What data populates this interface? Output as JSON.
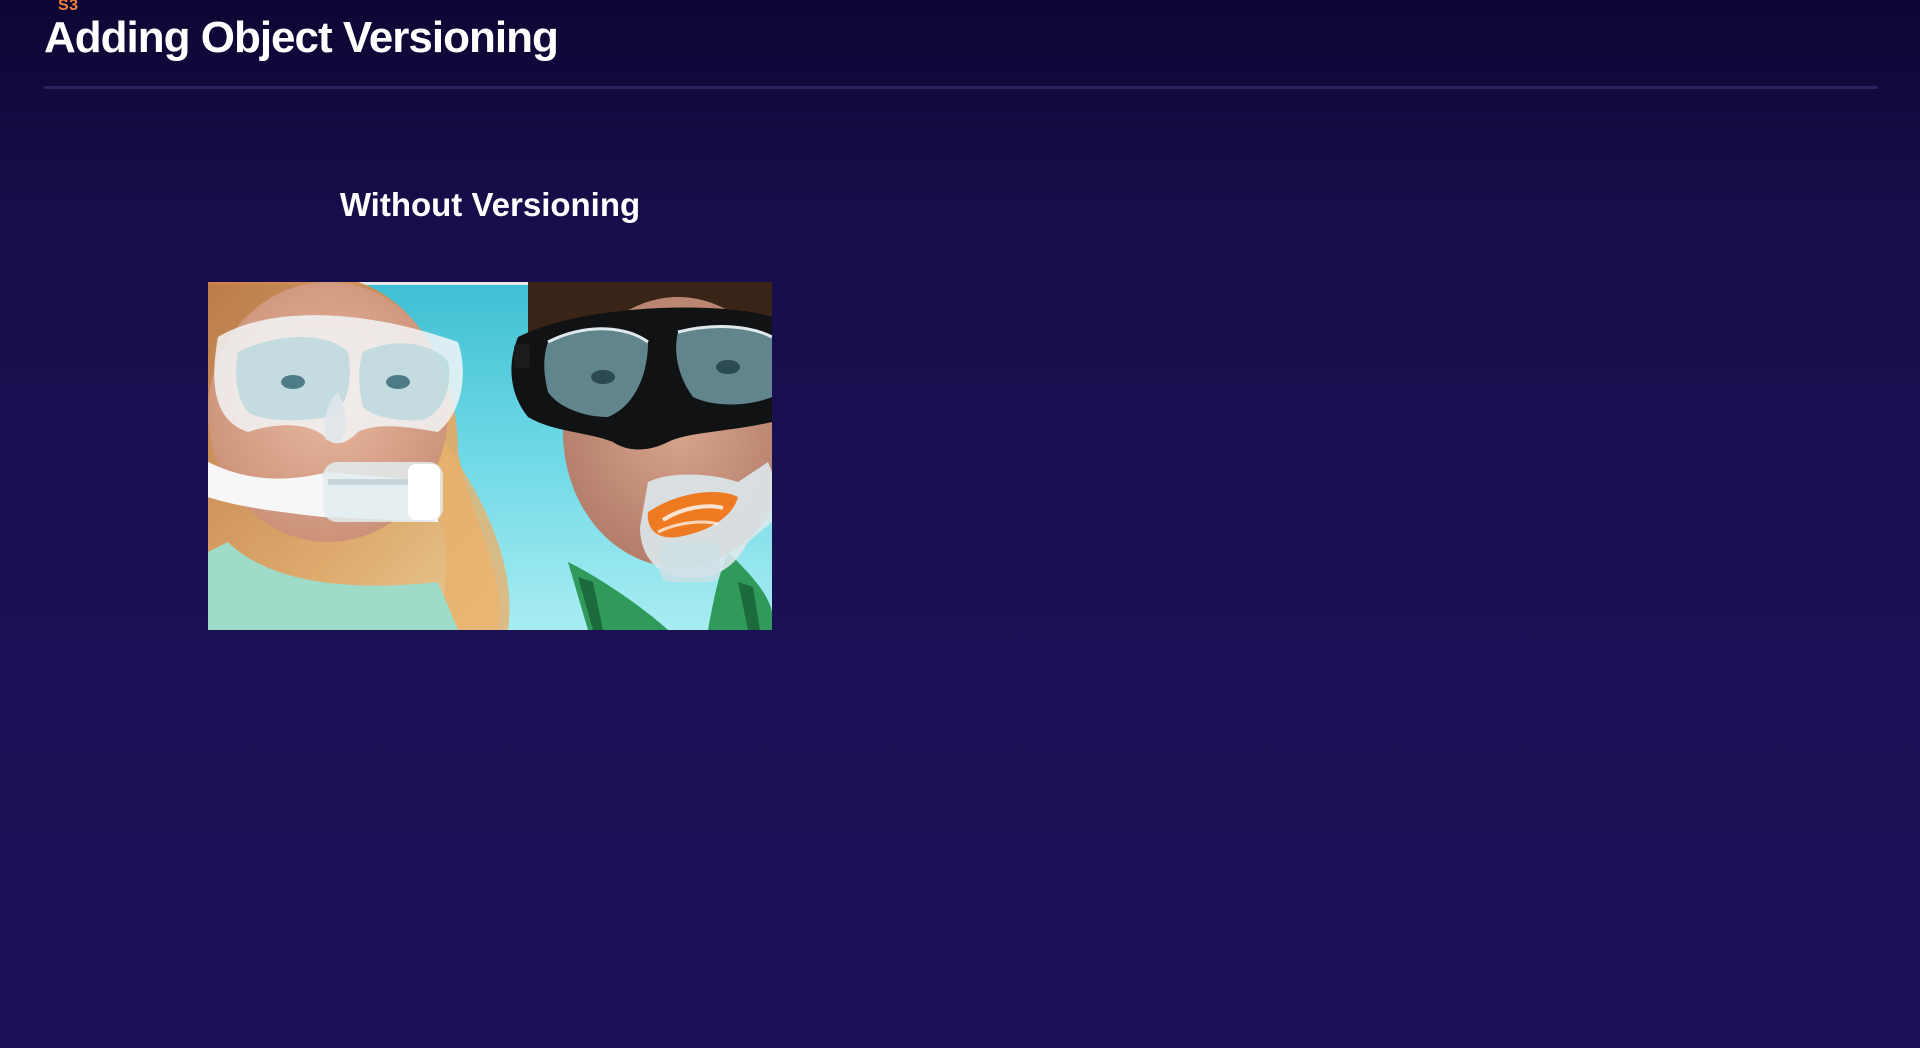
{
  "slide": {
    "kicker": "S3",
    "title": "Adding Object Versioning",
    "section_title": "Without Versioning"
  },
  "image": {
    "alt": "snorkelers-underwater-photo"
  },
  "colors": {
    "background_top": "#0e0633",
    "background_bottom": "#1c1258",
    "accent": "#f0823a",
    "divider": "#2a2263",
    "text": "#ffffff"
  }
}
